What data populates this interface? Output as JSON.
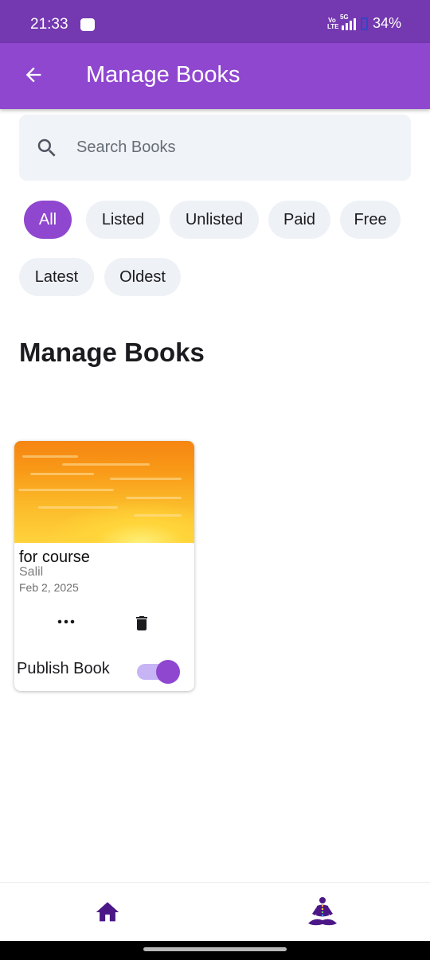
{
  "status_bar": {
    "time": "21:33",
    "volte": "Vo LTE",
    "network": "5G",
    "battery": "34%"
  },
  "app_bar": {
    "title": "Manage Books",
    "back_icon": "arrow-back-icon"
  },
  "search": {
    "placeholder": "Search Books",
    "value": "",
    "icon": "search-icon"
  },
  "filters": {
    "selected": "All",
    "chips": [
      "All",
      "Listed",
      "Unlisted",
      "Paid",
      "Free",
      "Latest",
      "Oldest"
    ]
  },
  "section": {
    "title": "Manage Books"
  },
  "books": [
    {
      "title": "for course",
      "author": "Salil",
      "date": "Feb 2, 2025",
      "cover": "sunset-sky-image",
      "actions": [
        "more-horizontal-icon",
        "delete-icon"
      ],
      "publish_label": "Publish Book",
      "published": true
    }
  ],
  "bottom_nav": {
    "items": [
      "home-icon",
      "meditation-icon"
    ]
  },
  "colors": {
    "primary": "#8f47cf",
    "status_bar": "#7438b0",
    "nav_icon": "#4b1787",
    "chip_bg": "#eef1f5",
    "toggle_track": "#c6b4f5"
  }
}
